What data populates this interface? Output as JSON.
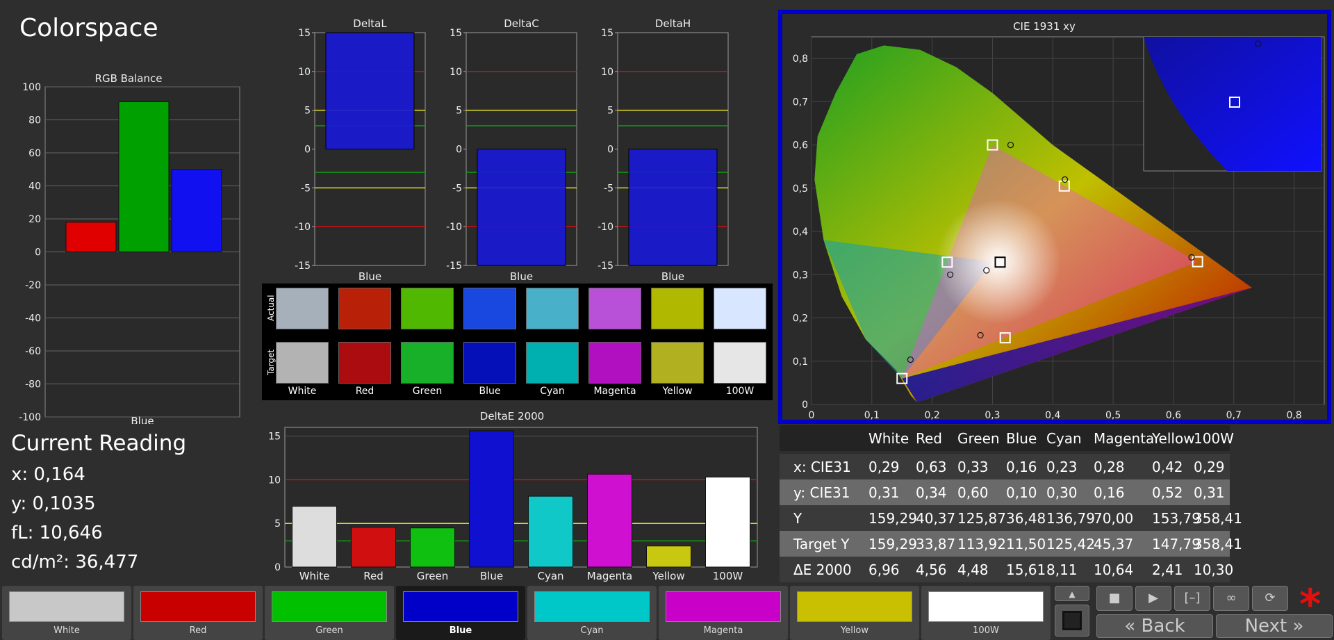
{
  "app_title": "Colorspace",
  "rgb_balance": {
    "title": "RGB Balance",
    "x_label": "Blue",
    "y_ticks": [
      "100",
      "80",
      "60",
      "40",
      "20",
      "0",
      "-20",
      "-40",
      "-60",
      "-80",
      "-100"
    ],
    "ylim": [
      -100,
      100
    ],
    "bars": [
      {
        "name": "red",
        "value": 18,
        "color": "#e00000"
      },
      {
        "name": "green",
        "value": 91,
        "color": "#00a000"
      },
      {
        "name": "blue",
        "value": 50,
        "color": "#1010f0"
      }
    ]
  },
  "delta_charts": [
    {
      "title": "DeltaL",
      "x_label": "Blue",
      "value": 15
    },
    {
      "title": "DeltaC",
      "x_label": "Blue",
      "value": -15
    },
    {
      "title": "DeltaH",
      "x_label": "Blue",
      "value": -15
    }
  ],
  "delta_ticks": [
    "15",
    "10",
    "5",
    "0",
    "-5",
    "-10",
    "-15"
  ],
  "swatches": {
    "actual_label": "Actual",
    "target_label": "Target",
    "items": [
      {
        "label": "White",
        "actual": "#a6b0bb",
        "target": "#b3b3b3"
      },
      {
        "label": "Red",
        "actual": "#b82008",
        "target": "#aa0c10"
      },
      {
        "label": "Green",
        "actual": "#50b800",
        "target": "#18b028"
      },
      {
        "label": "Blue",
        "actual": "#1848e0",
        "target": "#0610b8"
      },
      {
        "label": "Cyan",
        "actual": "#48b0c8",
        "target": "#00b0b0"
      },
      {
        "label": "Magenta",
        "actual": "#b850d8",
        "target": "#b010c0"
      },
      {
        "label": "Yellow",
        "actual": "#b0b800",
        "target": "#b0b020"
      },
      {
        "label": "100W",
        "actual": "#d8e6ff",
        "target": "#e6e6e6"
      }
    ]
  },
  "current_reading": {
    "heading": "Current Reading",
    "x": "x: 0,164",
    "y": "y: 0,1035",
    "fl": "fL: 10,646",
    "cdm2": "cd/m²: 36,477"
  },
  "chart_data": {
    "type": "bar",
    "title": "DeltaE 2000",
    "categories": [
      "White",
      "Red",
      "Green",
      "Blue",
      "Cyan",
      "Magenta",
      "Yellow",
      "100W"
    ],
    "values": [
      6.96,
      4.56,
      4.48,
      15.61,
      8.11,
      10.64,
      2.41,
      10.3
    ],
    "colors": [
      "#dddddd",
      "#d01010",
      "#10c010",
      "#1010d0",
      "#10c8c8",
      "#d010d0",
      "#c8c810",
      "#ffffff"
    ],
    "y_ticks": [
      "15",
      "10",
      "5",
      "0"
    ],
    "ylim": [
      0,
      16
    ]
  },
  "cie": {
    "title": "CIE 1931 xy",
    "x_ticks": [
      "0",
      "0,1",
      "0,2",
      "0,3",
      "0,4",
      "0,5",
      "0,6",
      "0,7",
      "0,8"
    ],
    "y_ticks": [
      "0,8",
      "0,7",
      "0,6",
      "0,5",
      "0,4",
      "0,3",
      "0,2",
      "0,1",
      "0"
    ],
    "targets": [
      {
        "name": "red",
        "x": 0.64,
        "y": 0.33
      },
      {
        "name": "green",
        "x": 0.3,
        "y": 0.6
      },
      {
        "name": "blue",
        "x": 0.15,
        "y": 0.06
      },
      {
        "name": "cyan",
        "x": 0.225,
        "y": 0.329
      },
      {
        "name": "magenta",
        "x": 0.321,
        "y": 0.154
      },
      {
        "name": "yellow",
        "x": 0.419,
        "y": 0.505
      },
      {
        "name": "white",
        "x": 0.3127,
        "y": 0.329
      }
    ],
    "measured": [
      {
        "name": "red",
        "x": 0.63,
        "y": 0.34
      },
      {
        "name": "green",
        "x": 0.33,
        "y": 0.6
      },
      {
        "name": "blue",
        "x": 0.164,
        "y": 0.1035
      },
      {
        "name": "cyan",
        "x": 0.23,
        "y": 0.3
      },
      {
        "name": "magenta",
        "x": 0.28,
        "y": 0.16
      },
      {
        "name": "yellow",
        "x": 0.42,
        "y": 0.52
      },
      {
        "name": "white",
        "x": 0.29,
        "y": 0.31
      }
    ]
  },
  "table": {
    "headers": [
      "",
      "White",
      "Red",
      "Green",
      "Blue",
      "Cyan",
      "Magenta",
      "Yellow",
      "100W"
    ],
    "rows": [
      [
        "x: CIE31",
        "0,29",
        "0,63",
        "0,33",
        "0,16",
        "0,23",
        "0,28",
        "0,42",
        "0,29"
      ],
      [
        "y: CIE31",
        "0,31",
        "0,34",
        "0,60",
        "0,10",
        "0,30",
        "0,16",
        "0,52",
        "0,31"
      ],
      [
        "Y",
        "159,29",
        "40,37",
        "125,87",
        "36,48",
        "136,79",
        "70,00",
        "153,79",
        "358,41"
      ],
      [
        "Target Y",
        "159,29",
        "33,87",
        "113,92",
        "11,50",
        "125,42",
        "45,37",
        "147,79",
        "358,41"
      ],
      [
        "ΔE 2000",
        "6,96",
        "4,56",
        "4,48",
        "15,61",
        "8,11",
        "10,64",
        "2,41",
        "10,30"
      ]
    ]
  },
  "bottom_tabs": [
    {
      "label": "White",
      "color": "#c8c8c8",
      "selected": false
    },
    {
      "label": "Red",
      "color": "#c80000",
      "selected": false
    },
    {
      "label": "Green",
      "color": "#00c000",
      "selected": false
    },
    {
      "label": "Blue",
      "color": "#0000c8",
      "selected": true
    },
    {
      "label": "Cyan",
      "color": "#00c8c8",
      "selected": false
    },
    {
      "label": "Magenta",
      "color": "#c800c8",
      "selected": false
    },
    {
      "label": "Yellow",
      "color": "#c8c000",
      "selected": false
    },
    {
      "label": "100W",
      "color": "#ffffff",
      "selected": false
    }
  ],
  "controls": {
    "back_label": "Back",
    "next_label": "Next",
    "icons": [
      "stop-icon",
      "play-icon",
      "bracket-icon",
      "infinity-icon",
      "refresh-icon"
    ],
    "asterisk": "*"
  }
}
